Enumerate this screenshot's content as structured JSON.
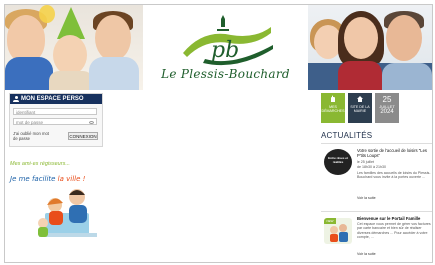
{
  "header": {
    "logo_text": "Le Plessis-Bouchard",
    "logo_mark": "pb",
    "colors": {
      "logo_green": "#1f5e2c",
      "accent_green": "#8ab832",
      "navy": "#17315e"
    }
  },
  "login": {
    "title": "MON ESPACE PERSO",
    "username_placeholder": "identifiant",
    "password_placeholder": "mot de passe",
    "forgot_text": "J'ai oublié mon mot de passe",
    "connect_label": "CONNEXION"
  },
  "help": {
    "title": "Mes ami·es régisseurs...",
    "subtitle_part1": "Je me facilite ",
    "subtitle_part2": "la ville !"
  },
  "tiles": [
    {
      "label": "MES DÉMARCHES",
      "icon": "hand-icon"
    },
    {
      "label": "SITE DE LA MAIRIE",
      "icon": "house-icon"
    },
    {
      "day": "25",
      "month": "JUILLET",
      "year": "2024"
    }
  ],
  "news": {
    "title": "ACTUALITÉS",
    "items": [
      {
        "thumb_text": "Entre rêves et réalités",
        "title": "Votre sortie de l'accueil de loisirs \"Les P'tits Loups\"",
        "date": "le 25 juillet",
        "time": "de 18h30 à 21h30",
        "body": "Les familles des accueils de loisirs du Plessis-Bouchard vous invite à la portes ouverte ...",
        "more": "Voir la suite"
      },
      {
        "badge": "NEW",
        "title": "Bienvenue sur le Portail Famille",
        "body": "Cet espace vous permet de gérer vos factures par carte bancaire et bien sûr de réaliser diverses démarches ... Pour accéder à votre compte, ...",
        "more": "Voir la suite"
      }
    ]
  }
}
